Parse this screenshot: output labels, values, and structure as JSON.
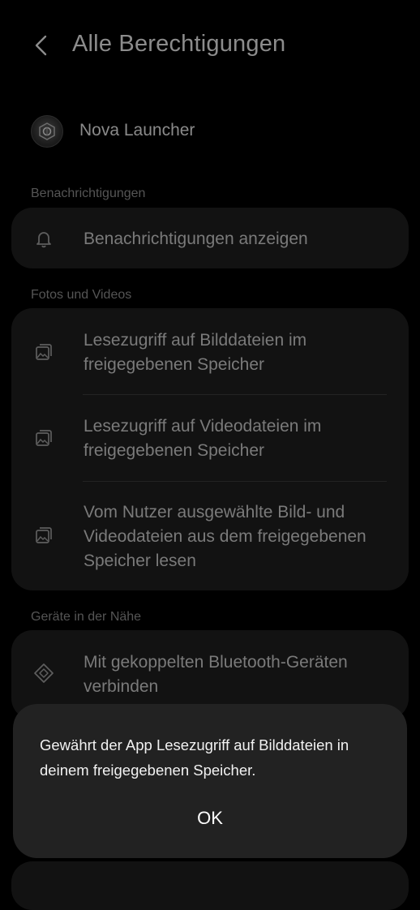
{
  "header": {
    "back_icon": "chevron-left-icon",
    "title": "Alle Berechtigungen"
  },
  "app": {
    "name": "Nova Launcher",
    "icon": "nova-launcher-icon"
  },
  "sections": [
    {
      "label": "Benachrichtigungen",
      "items": [
        {
          "icon": "bell-icon",
          "label": "Benachrichtigungen anzeigen"
        }
      ]
    },
    {
      "label": "Fotos und Videos",
      "items": [
        {
          "icon": "image-icon",
          "label": "Lesezugriff auf Bilddateien im freigegebenen Speicher"
        },
        {
          "icon": "image-icon",
          "label": "Lesezugriff auf Videodateien im freigegebenen Speicher"
        },
        {
          "icon": "image-icon",
          "label": "Vom Nutzer ausgewählte Bild- und Videodateien aus dem freigegebenen Speicher lesen"
        }
      ]
    },
    {
      "label": "Geräte in der Nähe",
      "items": [
        {
          "icon": "nearby-devices-icon",
          "label": "Mit gekoppelten Bluetooth-Geräten verbinden"
        }
      ]
    }
  ],
  "dialog": {
    "message": "Gewährt der App Lesezugriff auf Bilddateien in deinem freigegebenen Speicher.",
    "ok_label": "OK"
  },
  "colors": {
    "background": "#000000",
    "card": "#121212",
    "dialog": "#222222",
    "text_dim": "#7a7a7a"
  }
}
